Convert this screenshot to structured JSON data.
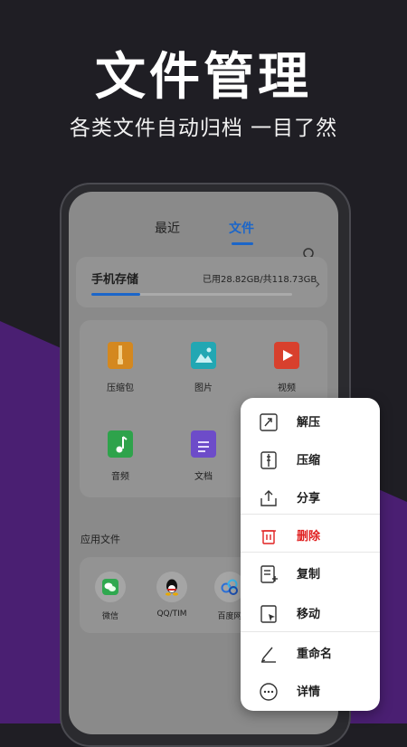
{
  "hero": {
    "title": "文件管理",
    "subtitle": "各类文件自动归档 一目了然"
  },
  "colors": {
    "background": "#1f1e24",
    "purple": "#4a1f72",
    "accent": "#1b66c9",
    "danger": "#e02020"
  },
  "tabs": [
    {
      "label": "最近"
    },
    {
      "label": "文件",
      "active": true
    }
  ],
  "storage": {
    "title": "手机存储",
    "usage": "已用28.82GB/共118.73GB",
    "used_fraction": 0.243
  },
  "categories": [
    {
      "label": "压缩包",
      "icon": "zip-icon",
      "color": "#d4881f"
    },
    {
      "label": "图片",
      "icon": "image-icon",
      "color": "#22a7b3"
    },
    {
      "label": "视频",
      "icon": "video-icon",
      "color": "#d8402d"
    },
    {
      "label": "音频",
      "icon": "music-icon",
      "color": "#2ea34b"
    },
    {
      "label": "文档",
      "icon": "document-icon",
      "color": "#6d4cc9"
    }
  ],
  "apps_section": {
    "title": "应用文件"
  },
  "apps": [
    {
      "label": "微信",
      "icon": "wechat-icon"
    },
    {
      "label": "QQ/TIM",
      "icon": "qq-icon"
    },
    {
      "label": "百度网",
      "icon": "baidu-netdisk-icon"
    }
  ],
  "menu": [
    {
      "label": "解压",
      "icon": "extract-icon"
    },
    {
      "label": "压缩",
      "icon": "compress-icon"
    },
    {
      "label": "分享",
      "icon": "share-icon"
    },
    {
      "label": "删除",
      "icon": "trash-icon",
      "danger": true
    },
    {
      "label": "复制",
      "icon": "copy-icon"
    },
    {
      "label": "移动",
      "icon": "move-icon"
    },
    {
      "label": "重命名",
      "icon": "rename-icon"
    },
    {
      "label": "详情",
      "icon": "details-icon"
    }
  ]
}
